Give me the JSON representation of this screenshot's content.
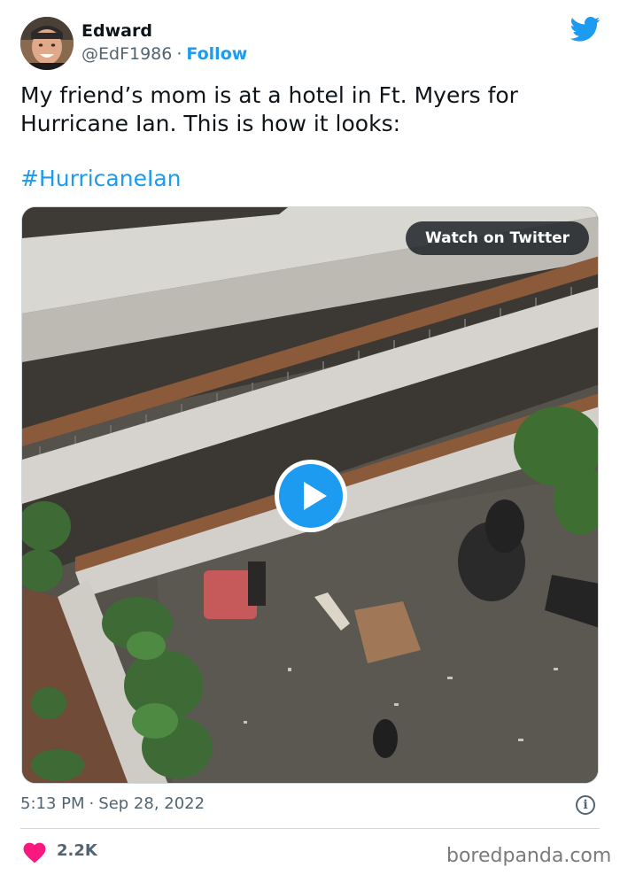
{
  "author": {
    "name": "Edward",
    "handle": "@EdF1986",
    "separator": "·",
    "follow_label": "Follow"
  },
  "tweet": {
    "text": "My friend’s mom is at a hotel in Ft. Myers for Hurricane Ian. This is how it looks:",
    "hashtag": "#HurricaneIan"
  },
  "media": {
    "watch_label": "Watch on Twitter",
    "play_icon": "play-icon"
  },
  "meta": {
    "time": "5:13 PM",
    "separator": "·",
    "date": "Sep 28, 2022",
    "info_symbol": "i"
  },
  "engagement": {
    "likes": "2.2K"
  },
  "watermark": "boredpanda.com",
  "colors": {
    "accent": "#1d9bf0",
    "like": "#f91880",
    "text": "#0f1419",
    "secondary": "#536471"
  },
  "icons": [
    "twitter-bird-icon",
    "heart-icon",
    "info-icon",
    "play-icon"
  ]
}
